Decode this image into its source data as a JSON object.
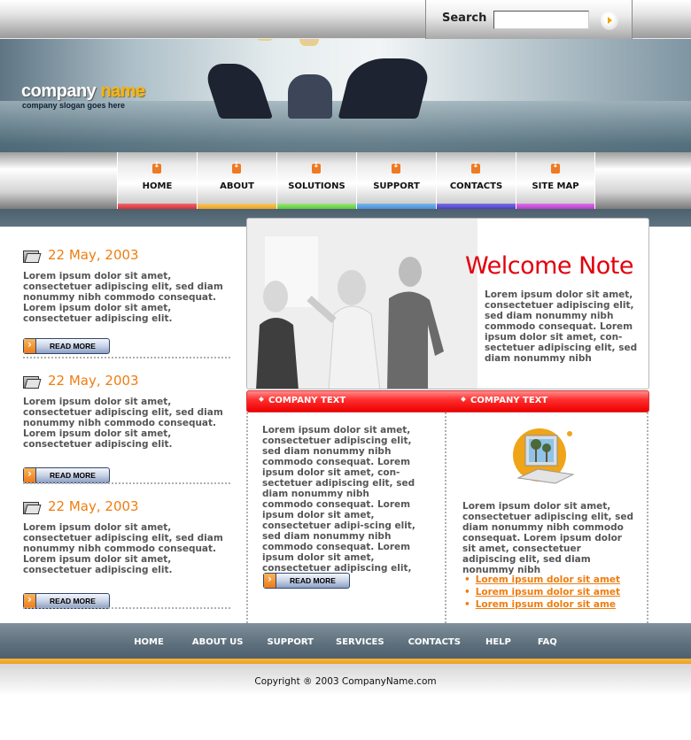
{
  "search": {
    "label": "Search",
    "value": "",
    "placeholder": "",
    "go_icon": "arrow-right-icon"
  },
  "brand": {
    "name_part1": "company",
    "name_part2": "name",
    "slogan": "company slogan goes here",
    "colors": {
      "name_white": "#ffffff",
      "name_yellow": "#f6b515"
    }
  },
  "nav": {
    "items": [
      {
        "label": "HOME",
        "stripe": "#e8434a"
      },
      {
        "label": "ABOUT",
        "stripe": "#f2b13c"
      },
      {
        "label": "SOLUTIONS",
        "stripe": "#78d84e"
      },
      {
        "label": "SUPPORT",
        "stripe": "#5aa0e0"
      },
      {
        "label": "CONTACTS",
        "stripe": "#5a4fd0"
      },
      {
        "label": "SITE MAP",
        "stripe": "#c84ad8"
      }
    ],
    "icon": "arrow-down-icon"
  },
  "news": [
    {
      "date": "22 May, 2003",
      "text": "Lorem ipsum dolor sit amet, consectetuer adipiscing elit, sed diam nonummy nibh commodo consequat. Lorem ipsum dolor sit amet, consectetuer adipiscing elit.",
      "button": "READ MORE"
    },
    {
      "date": "22 May, 2003",
      "text": "Lorem ipsum dolor sit amet, consectetuer adipiscing elit, sed diam nonummy nibh commodo consequat. Lorem ipsum dolor sit amet, consectetuer adipiscing elit.",
      "button": "READ MORE"
    },
    {
      "date": "22 May, 2003",
      "text": "Lorem ipsum dolor sit amet, consectetuer adipiscing elit, sed diam nonummy nibh commodo consequat. Lorem ipsum dolor sit amet, consectetuer adipiscing elit.",
      "button": "READ MORE"
    }
  ],
  "welcome": {
    "title": "Welcome Note",
    "text": "Lorem ipsum dolor sit amet, consectetuer adipiscing elit, sed diam nonummy nibh commodo consequat. Lorem ipsum dolor sit amet, con-sectetuer adipiscing elit, sed diam nonummy nibh",
    "title_color": "#e2000c"
  },
  "company_sections": [
    {
      "title": "COMPANY TEXT",
      "text": "Lorem ipsum dolor sit amet, consectetuer adipiscing elit, sed diam nonummy nibh commodo consequat. Lorem ipsum dolor sit amet, con-sectetuer adipiscing elit, sed diam nonummy nibh commodo consequat. Lorem ipsum dolor sit amet, consectetuer adipi-scing elit, sed diam nonummy nibh commodo consequat. Lorem ipsum dolor sit amet, consectetuer adipiscing elit,",
      "button": "READ MORE"
    },
    {
      "title": "COMPANY TEXT",
      "text": "Lorem ipsum dolor sit amet, consectetuer adipiscing elit, sed diam nonummy nibh commodo consequat. Lorem ipsum dolor sit amet, consectetuer adipiscing elit, sed diam nonummy nibh",
      "links": [
        "Lorem ipsum dolor sit amet",
        "Lorem ipsum dolor sit amet",
        "Lorem ipsum dolor sit ame"
      ],
      "image_icon": "computer-icon"
    }
  ],
  "footer": {
    "links": [
      "HOME",
      "ABOUT US",
      "SUPPORT",
      "SERVICES",
      "CONTACTS",
      "HELP",
      "FAQ"
    ],
    "copyright": "Copyright ® 2003 CompanyName.com",
    "accent": "#f7b436"
  }
}
